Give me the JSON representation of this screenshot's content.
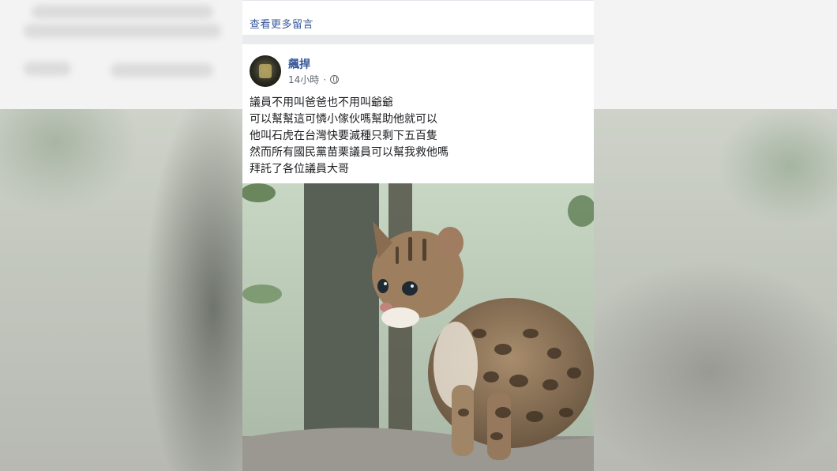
{
  "comments": {
    "view_more_label": "查看更多留言"
  },
  "post": {
    "author": "飆捍",
    "time": "14小時",
    "dot": "·",
    "privacy_icon": "globe-icon",
    "lines": [
      "議員不用叫爸爸也不用叫爺爺",
      "可以幫幫這可憐小傢伙嗎幫助他就可以",
      "他叫石虎在台灣快要滅種只剩下五百隻",
      "然而所有國民黨苗栗議員可以幫我救他嗎",
      "拜託了各位議員大哥"
    ],
    "photo_alt_subject": "leopard-cat-kitten-photo"
  },
  "colors": {
    "link": "#385898",
    "meta": "#606770",
    "text": "#1c1e21",
    "separator": "#e9ebee"
  }
}
